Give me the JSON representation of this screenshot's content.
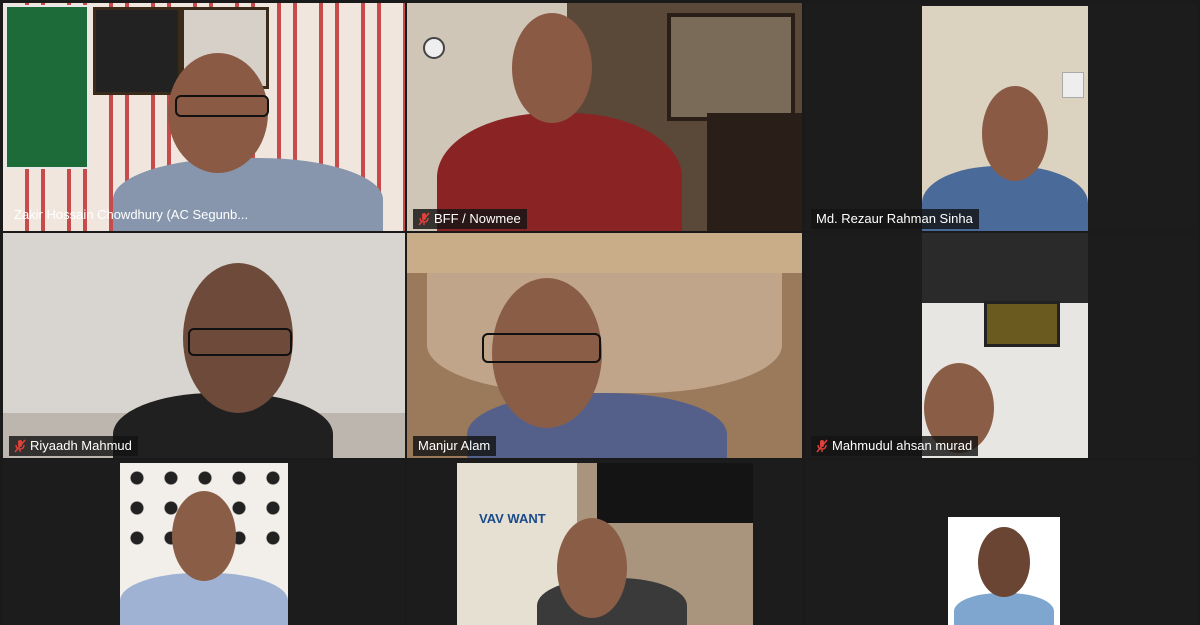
{
  "participants": [
    {
      "name": "Zakir Hossain Chowdhury (AC Segunb...",
      "muted": false,
      "active": true
    },
    {
      "name": "BFF / Nowmee",
      "muted": true,
      "active": false
    },
    {
      "name": "Md. Rezaur Rahman Sinha",
      "muted": false,
      "active": false
    },
    {
      "name": "Riyaadh Mahmud",
      "muted": true,
      "active": false
    },
    {
      "name": "Manjur Alam",
      "muted": false,
      "active": false
    },
    {
      "name": "Mahmudul ahsan murad",
      "muted": true,
      "active": false
    },
    {
      "name": "",
      "muted": false,
      "active": false
    },
    {
      "name": "",
      "muted": false,
      "active": false
    },
    {
      "name": "",
      "muted": false,
      "active": false
    }
  ],
  "colors": {
    "active_speaker_border": "#d9ef6a",
    "muted_icon": "#e0403a",
    "background": "#1a1a1a"
  },
  "icons": {
    "muted": "mic-off-icon"
  },
  "scene_text": {
    "poster_brand": "VAV WANT"
  }
}
